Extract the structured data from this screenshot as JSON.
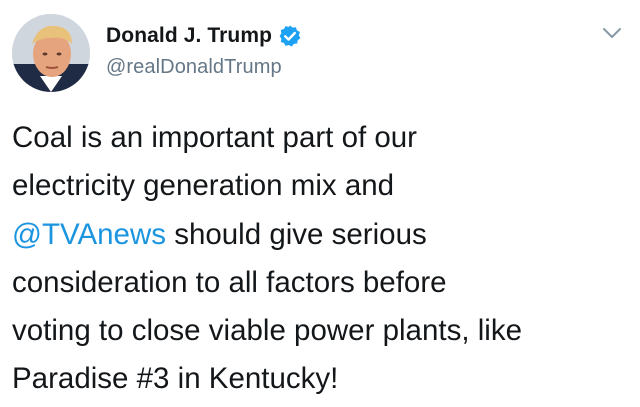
{
  "author": {
    "display_name": "Donald J. Trump",
    "handle": "@realDonaldTrump",
    "verified": true
  },
  "icons": {
    "verified": "verified-badge-icon",
    "menu": "chevron-down-icon",
    "avatar": "profile-photo"
  },
  "colors": {
    "text": "#14171a",
    "secondary": "#657786",
    "link": "#1b95e0",
    "verified": "#1da1f2"
  },
  "tweet": {
    "line1": "Coal is an important part of our",
    "line2": "electricity generation mix and",
    "mention": "@TVAnews",
    "line3_rest": " should give serious",
    "line4": "consideration to all factors before",
    "line5": "voting to close viable power plants, like",
    "line6": "Paradise #3 in Kentucky!"
  }
}
